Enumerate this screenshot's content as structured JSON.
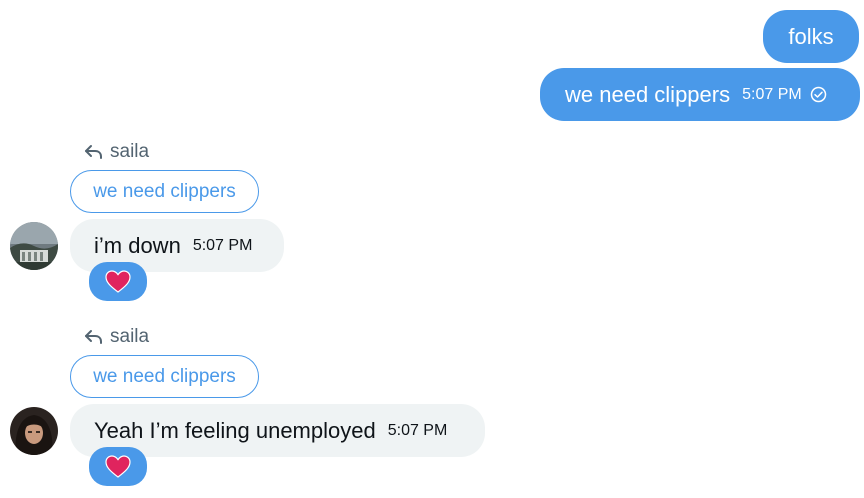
{
  "outgoing": [
    {
      "text": "folks"
    },
    {
      "text": "we need clippers",
      "time": "5:07 PM",
      "status_icon": "check-circle-icon"
    }
  ],
  "incoming": [
    {
      "reply_to_user": "saila",
      "quoted_text": "we need clippers",
      "text": "i’m down",
      "time": "5:07 PM",
      "reaction": "heart",
      "avatar": "avatar-landscape"
    },
    {
      "reply_to_user": "saila",
      "quoted_text": "we need clippers",
      "text": "Yeah I’m feeling unemployed",
      "time": "5:07 PM",
      "reaction": "heart",
      "avatar": "avatar-portrait"
    }
  ],
  "colors": {
    "outgoing_bubble": "#4a99e9",
    "incoming_bubble": "#eff3f4",
    "reaction_bg": "#4a99e9",
    "heart": "#e0245e"
  }
}
